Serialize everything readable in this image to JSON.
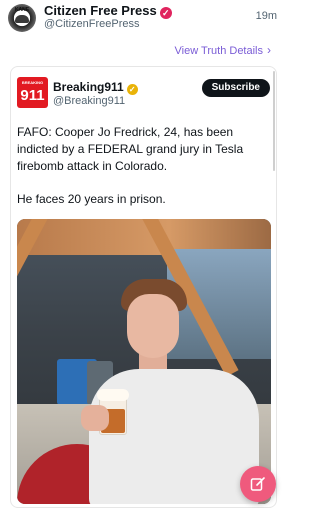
{
  "header": {
    "avatar_text": "KANE",
    "account_name": "Citizen Free Press",
    "handle": "@CitizenFreePress",
    "timestamp": "19m"
  },
  "truth_link": {
    "label": "View Truth Details"
  },
  "embedded": {
    "logo_small": "BREAKING",
    "logo_big": "911",
    "name": "Breaking911",
    "handle": "@Breaking911",
    "subscribe_label": "Subscribe",
    "paragraph1": "FAFO: Cooper Jo Fredrick, 24, has been indicted by a FEDERAL grand jury in Tesla firebomb attack in Colorado.",
    "paragraph2": "He faces 20 years in prison."
  },
  "colors": {
    "accent": "#7a5cd6",
    "fab": "#ef5a7d",
    "subscribe_bg": "#0f1419"
  },
  "icons": {
    "compose": "compose-icon",
    "chevron": "chevron-right-icon",
    "verified": "verified-icon"
  }
}
